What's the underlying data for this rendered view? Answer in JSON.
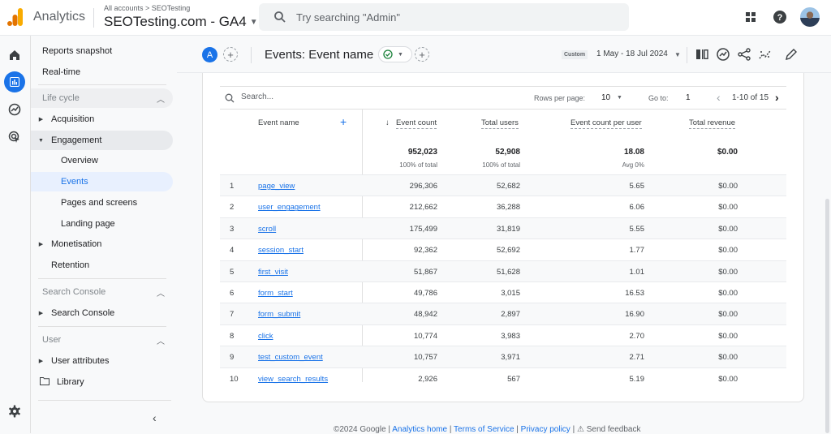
{
  "topbar": {
    "app_name": "Analytics",
    "breadcrumb": "All accounts > SEOTesting",
    "property": "SEOTesting.com - GA4",
    "search_placeholder": "Try searching \"Admin\""
  },
  "rail": {
    "items": [
      "home-icon",
      "reports-icon",
      "explore-icon",
      "advertising-icon"
    ],
    "settings": "gear-icon"
  },
  "sidebar": {
    "reports_snapshot": "Reports snapshot",
    "realtime": "Real-time",
    "lifecycle": {
      "heading": "Life cycle",
      "acquisition": "Acquisition",
      "engagement": "Engagement",
      "engagement_items": [
        "Overview",
        "Events",
        "Pages and screens",
        "Landing page"
      ],
      "monetisation": "Monetisation",
      "retention": "Retention"
    },
    "search_console": {
      "heading": "Search Console",
      "item": "Search Console"
    },
    "user": {
      "heading": "User",
      "item": "User attributes"
    },
    "library": "Library"
  },
  "header": {
    "comparison_chip": "A",
    "title": "Events: Event name",
    "date_tag": "Custom",
    "date_range": "1 May - 18 Jul 2024"
  },
  "table": {
    "search_placeholder": "Search...",
    "rows_per_page_label": "Rows per page:",
    "rows_per_page": "10",
    "goto_label": "Go to:",
    "goto_value": "1",
    "page_range": "1-10 of 15",
    "columns": {
      "dimension": "Event name",
      "event_count": "Event count",
      "total_users": "Total users",
      "per_user": "Event count per user",
      "revenue": "Total revenue"
    },
    "totals": {
      "event_count": "952,023",
      "event_count_sub": "100% of total",
      "total_users": "52,908",
      "total_users_sub": "100% of total",
      "per_user": "18.08",
      "per_user_sub": "Avg 0%",
      "revenue": "$0.00"
    },
    "rows": [
      {
        "idx": "1",
        "name": "page_view",
        "event_count": "296,306",
        "users": "52,682",
        "per_user": "5.65",
        "revenue": "$0.00"
      },
      {
        "idx": "2",
        "name": "user_engagement",
        "event_count": "212,662",
        "users": "36,288",
        "per_user": "6.06",
        "revenue": "$0.00"
      },
      {
        "idx": "3",
        "name": "scroll",
        "event_count": "175,499",
        "users": "31,819",
        "per_user": "5.55",
        "revenue": "$0.00"
      },
      {
        "idx": "4",
        "name": "session_start",
        "event_count": "92,362",
        "users": "52,692",
        "per_user": "1.77",
        "revenue": "$0.00"
      },
      {
        "idx": "5",
        "name": "first_visit",
        "event_count": "51,867",
        "users": "51,628",
        "per_user": "1.01",
        "revenue": "$0.00"
      },
      {
        "idx": "6",
        "name": "form_start",
        "event_count": "49,786",
        "users": "3,015",
        "per_user": "16.53",
        "revenue": "$0.00"
      },
      {
        "idx": "7",
        "name": "form_submit",
        "event_count": "48,942",
        "users": "2,897",
        "per_user": "16.90",
        "revenue": "$0.00"
      },
      {
        "idx": "8",
        "name": "click",
        "event_count": "10,774",
        "users": "3,983",
        "per_user": "2.70",
        "revenue": "$0.00"
      },
      {
        "idx": "9",
        "name": "test_custom_event",
        "event_count": "10,757",
        "users": "3,971",
        "per_user": "2.71",
        "revenue": "$0.00"
      },
      {
        "idx": "10",
        "name": "view_search_results",
        "event_count": "2,926",
        "users": "567",
        "per_user": "5.19",
        "revenue": "$0.00"
      }
    ]
  },
  "footer": {
    "copyright": "©2024 Google",
    "links": [
      "Analytics home",
      "Terms of Service",
      "Privacy policy"
    ],
    "feedback": "Send feedback"
  },
  "colors": {
    "accent": "#1a73e8",
    "logo_orange": "#f9ab00",
    "logo_dark_orange": "#e37400",
    "status_green": "#188038"
  }
}
